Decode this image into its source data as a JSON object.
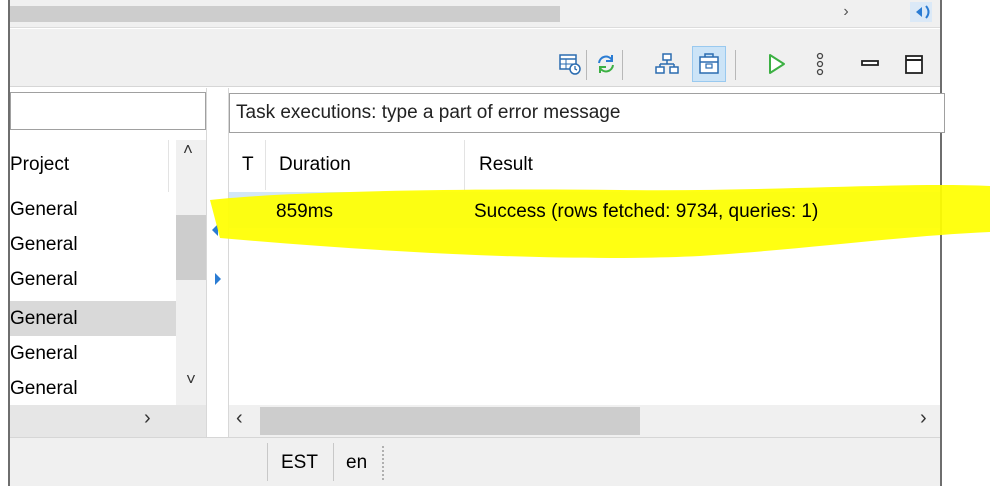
{
  "left_pane": {
    "header": {
      "project_label": "Project"
    },
    "rows": [
      {
        "project": "General",
        "selected": false
      },
      {
        "project": "General",
        "selected": false
      },
      {
        "project": "General",
        "selected": false
      },
      {
        "project": "General",
        "selected": true
      },
      {
        "project": "General",
        "selected": false
      },
      {
        "project": "General",
        "selected": false
      }
    ]
  },
  "toolbar": {
    "icons": [
      "schedule-table-icon",
      "refresh-sync-icon",
      "hierarchy-tree-icon",
      "package-box-icon",
      "run-play-icon",
      "more-options-icon",
      "minimize-icon",
      "maximize-icon"
    ],
    "selected_icon": "package-box-icon"
  },
  "task_executions": {
    "filter_placeholder": "Task executions: type a part of error message",
    "filter_value": "",
    "columns": [
      "T",
      "Duration",
      "Result"
    ],
    "rows": [
      {
        "type": "",
        "duration": "859ms",
        "result": "Success (rows fetched: 9734, queries: 1)"
      }
    ]
  },
  "status_bar": {
    "timezone": "EST",
    "locale": "en"
  },
  "colors": {
    "highlight_marker": "#ffff00",
    "selected_row": "#d3e7f7",
    "run_icon": "#3cb043",
    "accent_blue": "#2b7cd3"
  }
}
